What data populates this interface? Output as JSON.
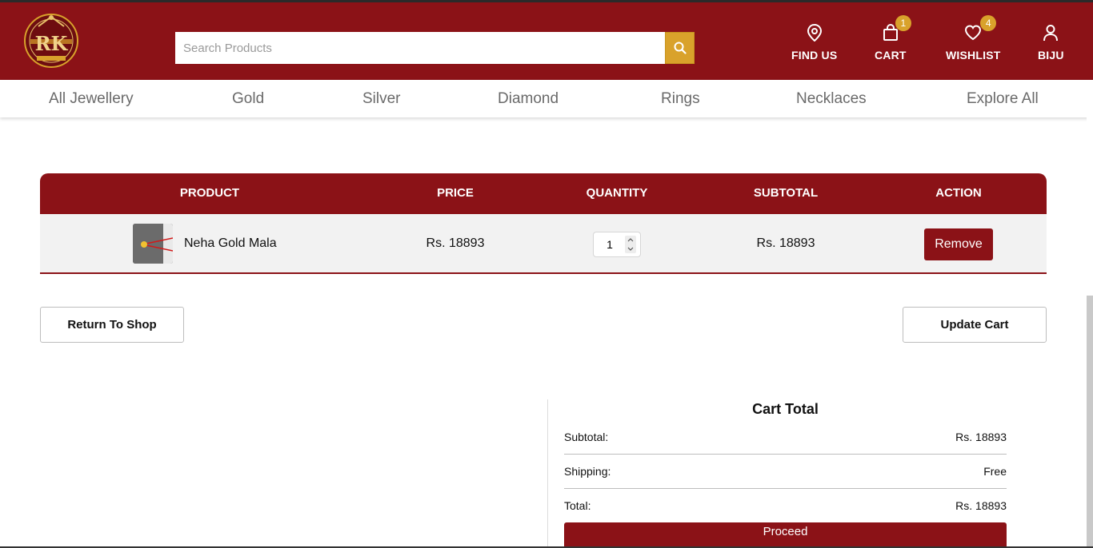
{
  "header": {
    "brand_initials": "RK",
    "search_placeholder": "Search Products",
    "nav": [
      {
        "label": "FIND US",
        "icon": "location-pin-icon"
      },
      {
        "label": "CART",
        "icon": "shopping-bag-icon",
        "badge": "1"
      },
      {
        "label": "WISHLIST",
        "icon": "heart-icon",
        "badge": "4"
      },
      {
        "label": "BIJU",
        "icon": "user-icon"
      }
    ]
  },
  "categories": [
    "All Jewellery",
    "Gold",
    "Silver",
    "Diamond",
    "Rings",
    "Necklaces",
    "Explore All"
  ],
  "cart_table": {
    "headers": [
      "PRODUCT",
      "PRICE",
      "QUANTITY",
      "SUBTOTAL",
      "ACTION"
    ],
    "rows": [
      {
        "name": "Neha Gold Mala",
        "price": "Rs. 18893",
        "quantity": "1",
        "subtotal": "Rs. 18893",
        "action": "Remove"
      }
    ]
  },
  "buttons": {
    "return": "Return To Shop",
    "update": "Update Cart"
  },
  "cart_total": {
    "title": "Cart Total",
    "subtotal_label": "Subtotal:",
    "subtotal_value": "Rs. 18893",
    "shipping_label": "Shipping:",
    "shipping_value": "Free",
    "total_label": "Total:",
    "total_value": "Rs. 18893",
    "proceed": "Proceed"
  },
  "colors": {
    "primary": "#8b1217",
    "accent": "#d9a22b"
  }
}
